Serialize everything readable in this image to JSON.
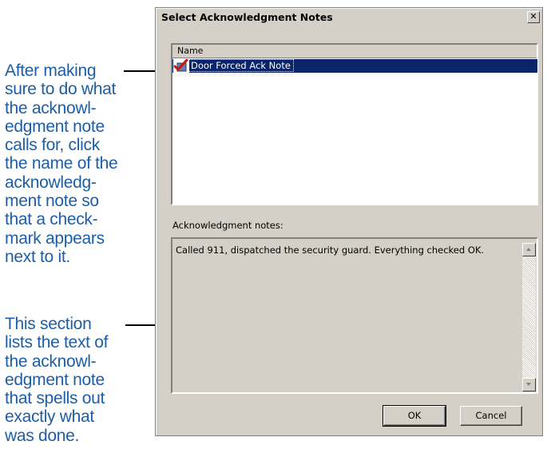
{
  "annotations": {
    "top": "After making\nsure to do what\nthe acknowl-\nedgment note\ncalls for, click\nthe name of the\nacknowledg-\nment note so\nthat a check-\nmark appears\nnext to it.",
    "bottom": "This section\nlists the text of\nthe acknowl-\nedgment note\nthat spells out\nexactly what\nwas done."
  },
  "dialog": {
    "title": "Select Acknowledgment Notes",
    "close_label": "✕",
    "list": {
      "column_header": "Name",
      "items": [
        {
          "label": "Door Forced Ack Note",
          "selected": true,
          "checked": true
        }
      ]
    },
    "notes_label": "Acknowledgment notes:",
    "notes_text": "Called 911, dispatched the security guard.  Everything checked OK.",
    "ok_label": "OK",
    "cancel_label": "Cancel"
  },
  "colors": {
    "callout_text": "#1c5ea8",
    "selection": "#0a246a",
    "dialog_face": "#d4d0c8",
    "checkmark": "#cc1111"
  }
}
